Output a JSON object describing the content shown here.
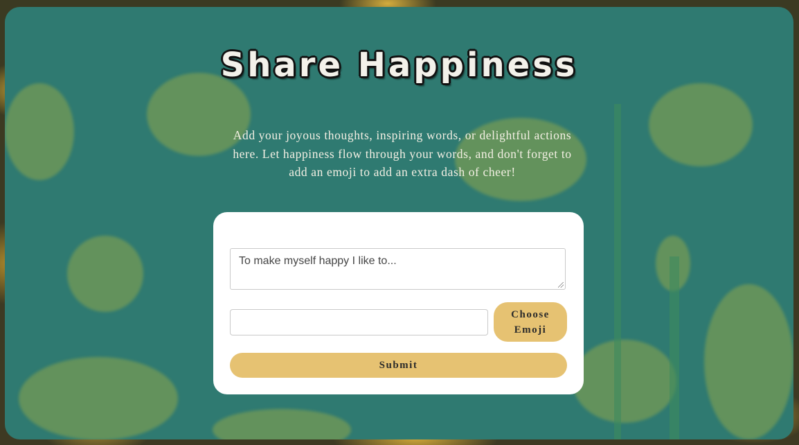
{
  "header": {
    "title": "Share Happiness",
    "description": "Add your joyous thoughts, inspiring words, or delightful actions here. Let happiness flow through your words, and don't forget to add an emoji to add an extra dash of cheer!"
  },
  "form": {
    "thought_placeholder": "To make myself happy I like to...",
    "emoji_value": "",
    "choose_emoji_label": "Choose Emoji",
    "submit_label": "Submit"
  },
  "colors": {
    "panel": "#2f7a71",
    "accent_button": "#e6c272",
    "card": "#ffffff"
  }
}
